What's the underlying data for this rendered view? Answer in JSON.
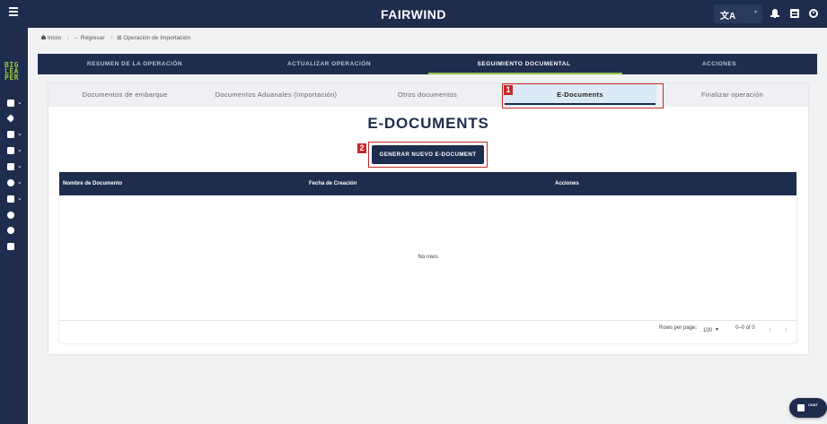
{
  "header": {
    "brand": "FAIRWIND",
    "lang_glyph": "文A",
    "lang_caret": "▾"
  },
  "logo": {
    "lines": [
      "BIG",
      "LEA",
      "PER"
    ]
  },
  "breadcrumb": {
    "home": "Inicio",
    "back": "← Regresar",
    "current": "⊞ Operación de Importación",
    "separator": "/"
  },
  "operation_tabs": [
    "RESUMEN DE LA OPERACIÓN",
    "ACTUALIZAR OPERACIÓN",
    "SEGUIMIENTO DOCUMENTAL",
    "ACCIONES"
  ],
  "document_tabs": [
    "Documentos de embarque",
    "Documentos Aduanales (Importación)",
    "Otros documentos",
    "E-Documents",
    "Finalizar operación"
  ],
  "annotations": {
    "badge_1": "1",
    "badge_2": "2"
  },
  "main": {
    "title": "E-DOCUMENTS",
    "generate_button": "GENERAR NUEVO E-DOCUMENT"
  },
  "table": {
    "columns": [
      "Nombre de Documento",
      "Fecha de Creación",
      "Acciones"
    ],
    "empty_text": "No rows",
    "rows_per_page_label": "Rows per page:",
    "rows_per_page_value": "100",
    "rows_per_page_caret": "▾",
    "range": "0–0 of 0",
    "prev": "‹",
    "next": "›"
  },
  "chat_fab": {
    "label": "CHAT"
  },
  "colors": {
    "navy": "#1e2d4d",
    "accent_green": "#8bc34a",
    "highlight_red": "#c62828",
    "active_tab_bg": "#dceaf7"
  }
}
